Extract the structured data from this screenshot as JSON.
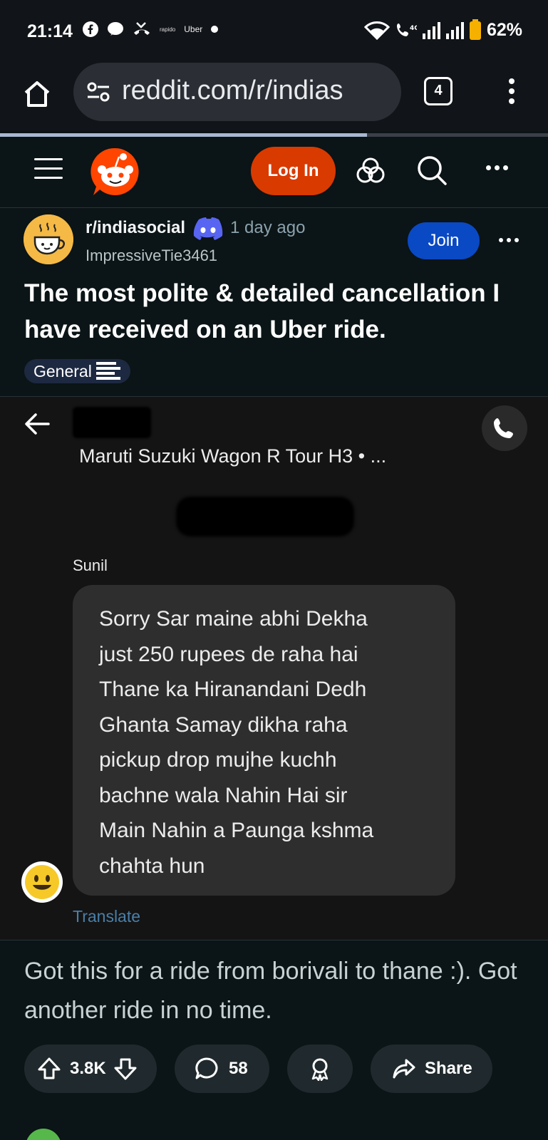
{
  "status_bar": {
    "time": "21:14",
    "left_icons": [
      "facebook-icon",
      "messenger-icon",
      "missed-call-icon",
      "rapido-icon",
      "uber-icon",
      "dot-icon"
    ],
    "rapido_label": "rapido",
    "uber_label": "Uber",
    "right_icons": [
      "wifi-icon",
      "volte-icon",
      "signal-icon",
      "signal-icon",
      "battery-icon"
    ],
    "battery": "62%",
    "battery_color": "#f6b100"
  },
  "browser": {
    "url": "reddit.com/r/indias",
    "tab_count": "4",
    "load_progress": 0.67
  },
  "reddit_header": {
    "login_label": "Log In",
    "brand_color": "#ff4500",
    "login_color": "#d93a00"
  },
  "post": {
    "subreddit": "r/indiasocial",
    "time_ago": "1 day ago",
    "author": "ImpressiveTie3461",
    "join_label": "Join",
    "title": "The most polite & detailed cancellation I have received on an Uber ride.",
    "flair": "General",
    "body": "Got this for a ride from borivali to thane :). Got another ride in no time."
  },
  "screenshot": {
    "vehicle": "Maruti Suzuki Wagon R Tour H3 • ...",
    "sender": "Sunil",
    "message_lines": [
      "Sorry Sar maine abhi Dekha",
      "just 250 rupees de raha hai",
      "Thane ka Hiranandani Dedh",
      "Ghanta Samay dikha raha",
      "pickup drop mujhe kuchh",
      "bachne wala Nahin Hai sir",
      "Main Nahin a Paunga kshma",
      "chahta hun"
    ],
    "translate_label": "Translate"
  },
  "actions": {
    "upvotes": "3.8K",
    "comments": "58",
    "share_label": "Share"
  }
}
